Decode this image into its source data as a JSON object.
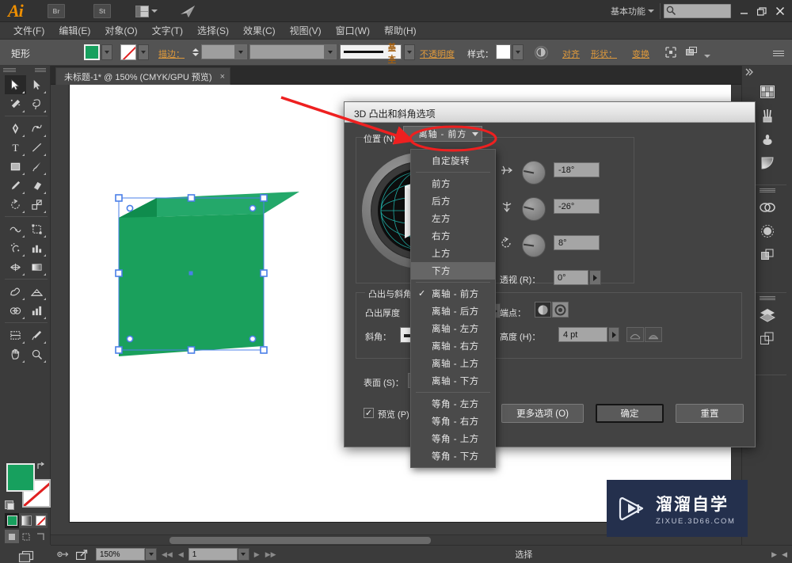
{
  "app": {
    "name": "Ai",
    "workspace": "基本功能",
    "title_icons": [
      "bridge-icon",
      "stock-icon",
      "arrange-documents-icon",
      "behance-icon"
    ],
    "window_buttons": {
      "minimize": "—",
      "restore": "❐",
      "close": "✕"
    },
    "search_placeholder": ""
  },
  "menu": {
    "items": [
      "文件(F)",
      "编辑(E)",
      "对象(O)",
      "文字(T)",
      "选择(S)",
      "效果(C)",
      "视图(V)",
      "窗口(W)",
      "帮助(H)"
    ]
  },
  "control_bar": {
    "object_type": "矩形",
    "fill_color": "#17a05e",
    "stroke_color": "none",
    "stroke_label": "描边：",
    "stroke_weight": "",
    "stroke_profile": "",
    "brush_label": "基本",
    "opacity_label": "不透明度",
    "style_label": "样式：",
    "align_label": "对齐",
    "shape_label": "形状：",
    "transform_label": "变换",
    "isolate_icon": "isolate-selection-icon",
    "arrange_icon": "arrange-icon",
    "panel_menu_icon": "panel-menu-icon"
  },
  "document_tab": {
    "label": "未标题-1* @ 150% (CMYK/GPU 预览)",
    "close": "×"
  },
  "tools": {
    "column1": [
      "selection-tool",
      "magic-wand-tool",
      "pen-tool",
      "type-tool",
      "rectangle-tool",
      "paintbrush-pencil-tool",
      "rotate-tool",
      "width-tool",
      "symbol-sprayer-tool",
      "mesh-tool",
      "blob-brush-tool",
      "shape-builder-tool",
      "slice-tool",
      "hand-tool"
    ],
    "column2": [
      "direct-selection-tool",
      "lasso-tool",
      "curvature-tool",
      "line-segment-tool",
      "paintbrush-tool",
      "eraser-tool",
      "scale-tool",
      "free-transform-tool",
      "column-graph-tool",
      "gradient-tool",
      "perspective-grid-tool",
      "column-graph-2-tool",
      "eyedropper-tool",
      "zoom-tool"
    ],
    "fill_color": "#17a05e",
    "stroke_color": "none",
    "swap-icon": "swap-fill-stroke-icon",
    "default-icon": "default-fill-stroke-icon",
    "color_modes": [
      "color-swatch-mode",
      "gradient-mode",
      "none-mode"
    ],
    "draw_modes": [
      "draw-normal",
      "draw-behind",
      "draw-inside"
    ],
    "screen_mode": "change-screen-mode-icon"
  },
  "right_panel": {
    "buttons": [
      "color-panel-icon",
      "brushes-panel-icon",
      "symbols-panel-icon",
      "gradient-panel-icon",
      "links-panel-icon",
      "transparency-panel-icon",
      "align-panel-icon",
      "layers-panel-icon",
      "artboards-panel-icon"
    ],
    "collapse_icon": "collapse-panels-icon"
  },
  "status_bar": {
    "zoom": "150%",
    "page": "1",
    "status_text": "选择",
    "nav_first": "◀◀",
    "nav_prev": "◀",
    "nav_next": "▶",
    "nav_last": "▶▶"
  },
  "dialog": {
    "title": "3D 凸出和斜角选项",
    "position_label": "位置 (N)：",
    "position_value": "离轴 - 前方",
    "angles": [
      {
        "icon": "rotate-x-axis-icon",
        "value": "-18°",
        "needle_deg": 18
      },
      {
        "icon": "rotate-y-axis-icon",
        "value": "-26°",
        "needle_deg": 26
      },
      {
        "icon": "rotate-z-axis-icon",
        "value": "8°",
        "needle_deg": 8
      }
    ],
    "perspective_label": "透视 (R)：",
    "perspective_value": "0°",
    "extrude_group_label": "凸出与斜角",
    "extrude_depth_label": "凸出厚度",
    "extrude_depth_value": "",
    "cap_label": "端点：",
    "bevel_label": "斜角：",
    "bevel_height_label": "高度 (H)：",
    "bevel_height_value": "4 pt",
    "surface_label": "表面 (S)：",
    "surface_value": "",
    "preview_label": "预览 (P)",
    "preview_checked": "✓",
    "buttons": {
      "more_options": "更多选项 (O)",
      "ok": "确定",
      "reset": "重置"
    }
  },
  "position_dropdown": {
    "items": [
      {
        "label": "自定旋转",
        "checked": false,
        "highlight": false,
        "sep_after": true
      },
      {
        "label": "前方",
        "checked": false,
        "highlight": false
      },
      {
        "label": "后方",
        "checked": false,
        "highlight": false
      },
      {
        "label": "左方",
        "checked": false,
        "highlight": false
      },
      {
        "label": "右方",
        "checked": false,
        "highlight": false
      },
      {
        "label": "上方",
        "checked": false,
        "highlight": false
      },
      {
        "label": "下方",
        "checked": false,
        "highlight": true,
        "sep_after": true
      },
      {
        "label": "离轴 - 前方",
        "checked": true,
        "highlight": false
      },
      {
        "label": "离轴 - 后方",
        "checked": false,
        "highlight": false
      },
      {
        "label": "离轴 - 左方",
        "checked": false,
        "highlight": false
      },
      {
        "label": "离轴 - 右方",
        "checked": false,
        "highlight": false
      },
      {
        "label": "离轴 - 上方",
        "checked": false,
        "highlight": false
      },
      {
        "label": "离轴 - 下方",
        "checked": false,
        "highlight": false,
        "sep_after": true
      },
      {
        "label": "等角 - 左方",
        "checked": false,
        "highlight": false
      },
      {
        "label": "等角 - 右方",
        "checked": false,
        "highlight": false
      },
      {
        "label": "等角 - 上方",
        "checked": false,
        "highlight": false
      },
      {
        "label": "等角 - 下方",
        "checked": false,
        "highlight": false
      }
    ]
  },
  "artwork": {
    "shape": "3d-extruded-rectangle",
    "fill_color": "#1aa05c",
    "top_color": "#24a86a",
    "side_color": "#0f8c4d",
    "selection_color": "#4a7fe8"
  },
  "annotation": {
    "arrow_color": "#ee2020",
    "ellipse_color": "#ee2020"
  },
  "watermark": {
    "cn": "溜溜自学",
    "en": "ZIXUE.3D66.COM",
    "bg": "#24304d"
  }
}
